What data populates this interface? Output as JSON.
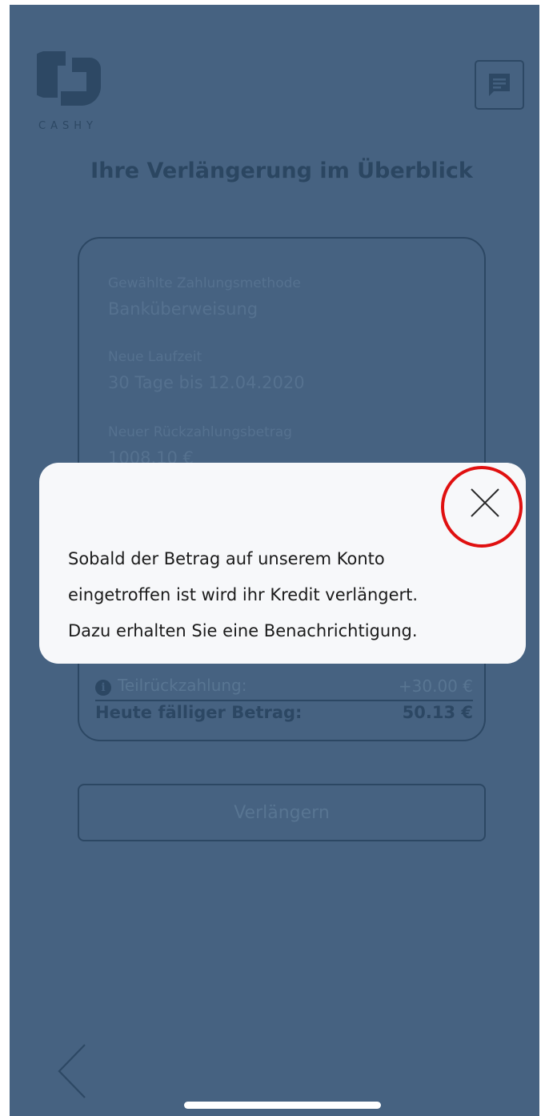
{
  "app": {
    "brand": "CASHY",
    "title": "Ihre Verlängerung im Überblick"
  },
  "card": {
    "payment_method_label": "Gewählte Zahlungsmethode",
    "payment_method_value": "Banküberweisung",
    "term_label": "Neue Laufzeit",
    "term_value": "30 Tage bis 12.04.2020",
    "repayment_label": "Neuer Rückzahlungsbetrag",
    "repayment_value": "1008.10 €",
    "partial_label": "Teilrückzahlung:",
    "partial_value": "+30.00 €",
    "info_glyph": "i",
    "due_label": "Heute fälliger Betrag:",
    "due_value": "50.13 €"
  },
  "extend_button": "Verlängern",
  "modal": {
    "lines": [
      "Sobald der Betrag auf unserem Konto",
      "eingetroffen ist wird ihr Kredit verlängert.",
      "Dazu erhalten Sie eine Benachrichtigung."
    ]
  },
  "colors": {
    "overlay": "#43607f",
    "modal_bg": "#f7f8fa",
    "highlight": "#e01010"
  },
  "icons": [
    "cashy-logo-icon",
    "chat-icon",
    "close-icon",
    "info-icon",
    "back-chevron-icon"
  ]
}
